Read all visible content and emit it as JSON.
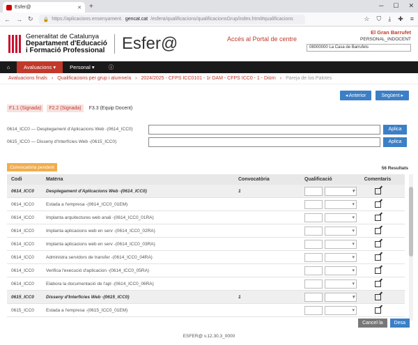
{
  "browser": {
    "tab_title": "Esfer@",
    "url_prefix": "https://aplicacions.ensenyament.",
    "url_host": "gencat.cat",
    "url_rest": "/esfera/qualificacions/qualificacionsGrup/index.html#qualificacions"
  },
  "header": {
    "gencat_line1": "Generalitat de Catalunya",
    "gencat_line2": "Departament d'Educació",
    "gencat_line3": "i Formació Professional",
    "app_name": "Esfer@",
    "portal_link": "Accés al Portal de centre",
    "user_name": "El Gran Barrufet",
    "user_role": "PERSONAL_INDOCENT",
    "center_select": "08000000 La Casa de Barrufets"
  },
  "nav": {
    "items": [
      {
        "label": "Avaluacions ▾"
      },
      {
        "label": "Personal ▾"
      }
    ]
  },
  "breadcrumb": {
    "items": [
      "Avaluacions finals",
      "Qualificacions per grup i alumne/a",
      "2024/2025 - CFPS ICC0101 - 1r DAM - CFPS ICC0 - 1 - Diürn",
      "Pareja de los Palotes"
    ]
  },
  "actions": {
    "prev_label": "◂ Anterior",
    "next_label": "Següent ▸"
  },
  "eval_tabs": [
    "F1.1 (Signada)",
    "F2.2 (Signada)",
    "F3.3 (Equip Docent)"
  ],
  "filters": [
    {
      "label": "0614_ICC0 — Desplegament d'Aplicacions Web -(0614_ICC0)",
      "apply": "Aplica"
    },
    {
      "label": "0615_ICC0 — Disseny d'Interfícies Web -(0615_ICC0)",
      "apply": "Aplica"
    }
  ],
  "table": {
    "badge": "Convocatòria pendent",
    "results_count": "56 Resultats",
    "headers": {
      "codi": "Codi",
      "materia": "Matèria",
      "convocatoria": "Convocatòria",
      "qualificacio": "Qualificació",
      "comentaris": "Comentaris"
    },
    "rows": [
      {
        "type": "group",
        "codi": "0614_ICC0",
        "materia": "Desplegament d'Aplicacions Web -(0614_ICC0)",
        "conv": "1"
      },
      {
        "type": "item",
        "codi": "0614_ICC0",
        "materia": "Estada a l'empresa -(0614_ICC0_01EM)",
        "conv": ""
      },
      {
        "type": "item",
        "codi": "0614_ICC0",
        "materia": "Implanta arquitectures web anali -(0614_ICC0_01RA)",
        "conv": ""
      },
      {
        "type": "item",
        "codi": "0614_ICC0",
        "materia": "Implanta aplicacions web en serv -(0614_ICC0_02RA)",
        "conv": ""
      },
      {
        "type": "item",
        "codi": "0614_ICC0",
        "materia": "Implanta aplicacions web en serv -(0614_ICC0_03RA)",
        "conv": ""
      },
      {
        "type": "item",
        "codi": "0614_ICC0",
        "materia": "Administra servidors de transfer -(0614_ICC0_04RA)",
        "conv": ""
      },
      {
        "type": "item",
        "codi": "0614_ICC0",
        "materia": "Verifica l'execució d'aplicacion -(0614_ICC0_05RA)",
        "conv": ""
      },
      {
        "type": "item",
        "codi": "0614_ICC0",
        "materia": "Elabora la documentació de l'apl -(0614_ICC0_06RA)",
        "conv": ""
      },
      {
        "type": "group",
        "codi": "0615_ICC0",
        "materia": "Disseny d'Interfícies Web -(0615_ICC0)",
        "conv": "1"
      },
      {
        "type": "item",
        "codi": "0615_ICC0",
        "materia": "Estada a l'empresa -(0615_ICC0_01EM)",
        "conv": ""
      }
    ]
  },
  "footer": {
    "cancel_label": "Cancel·la",
    "save_label": "Desa",
    "version": "ESFER@ v.12.30.3_0000"
  }
}
